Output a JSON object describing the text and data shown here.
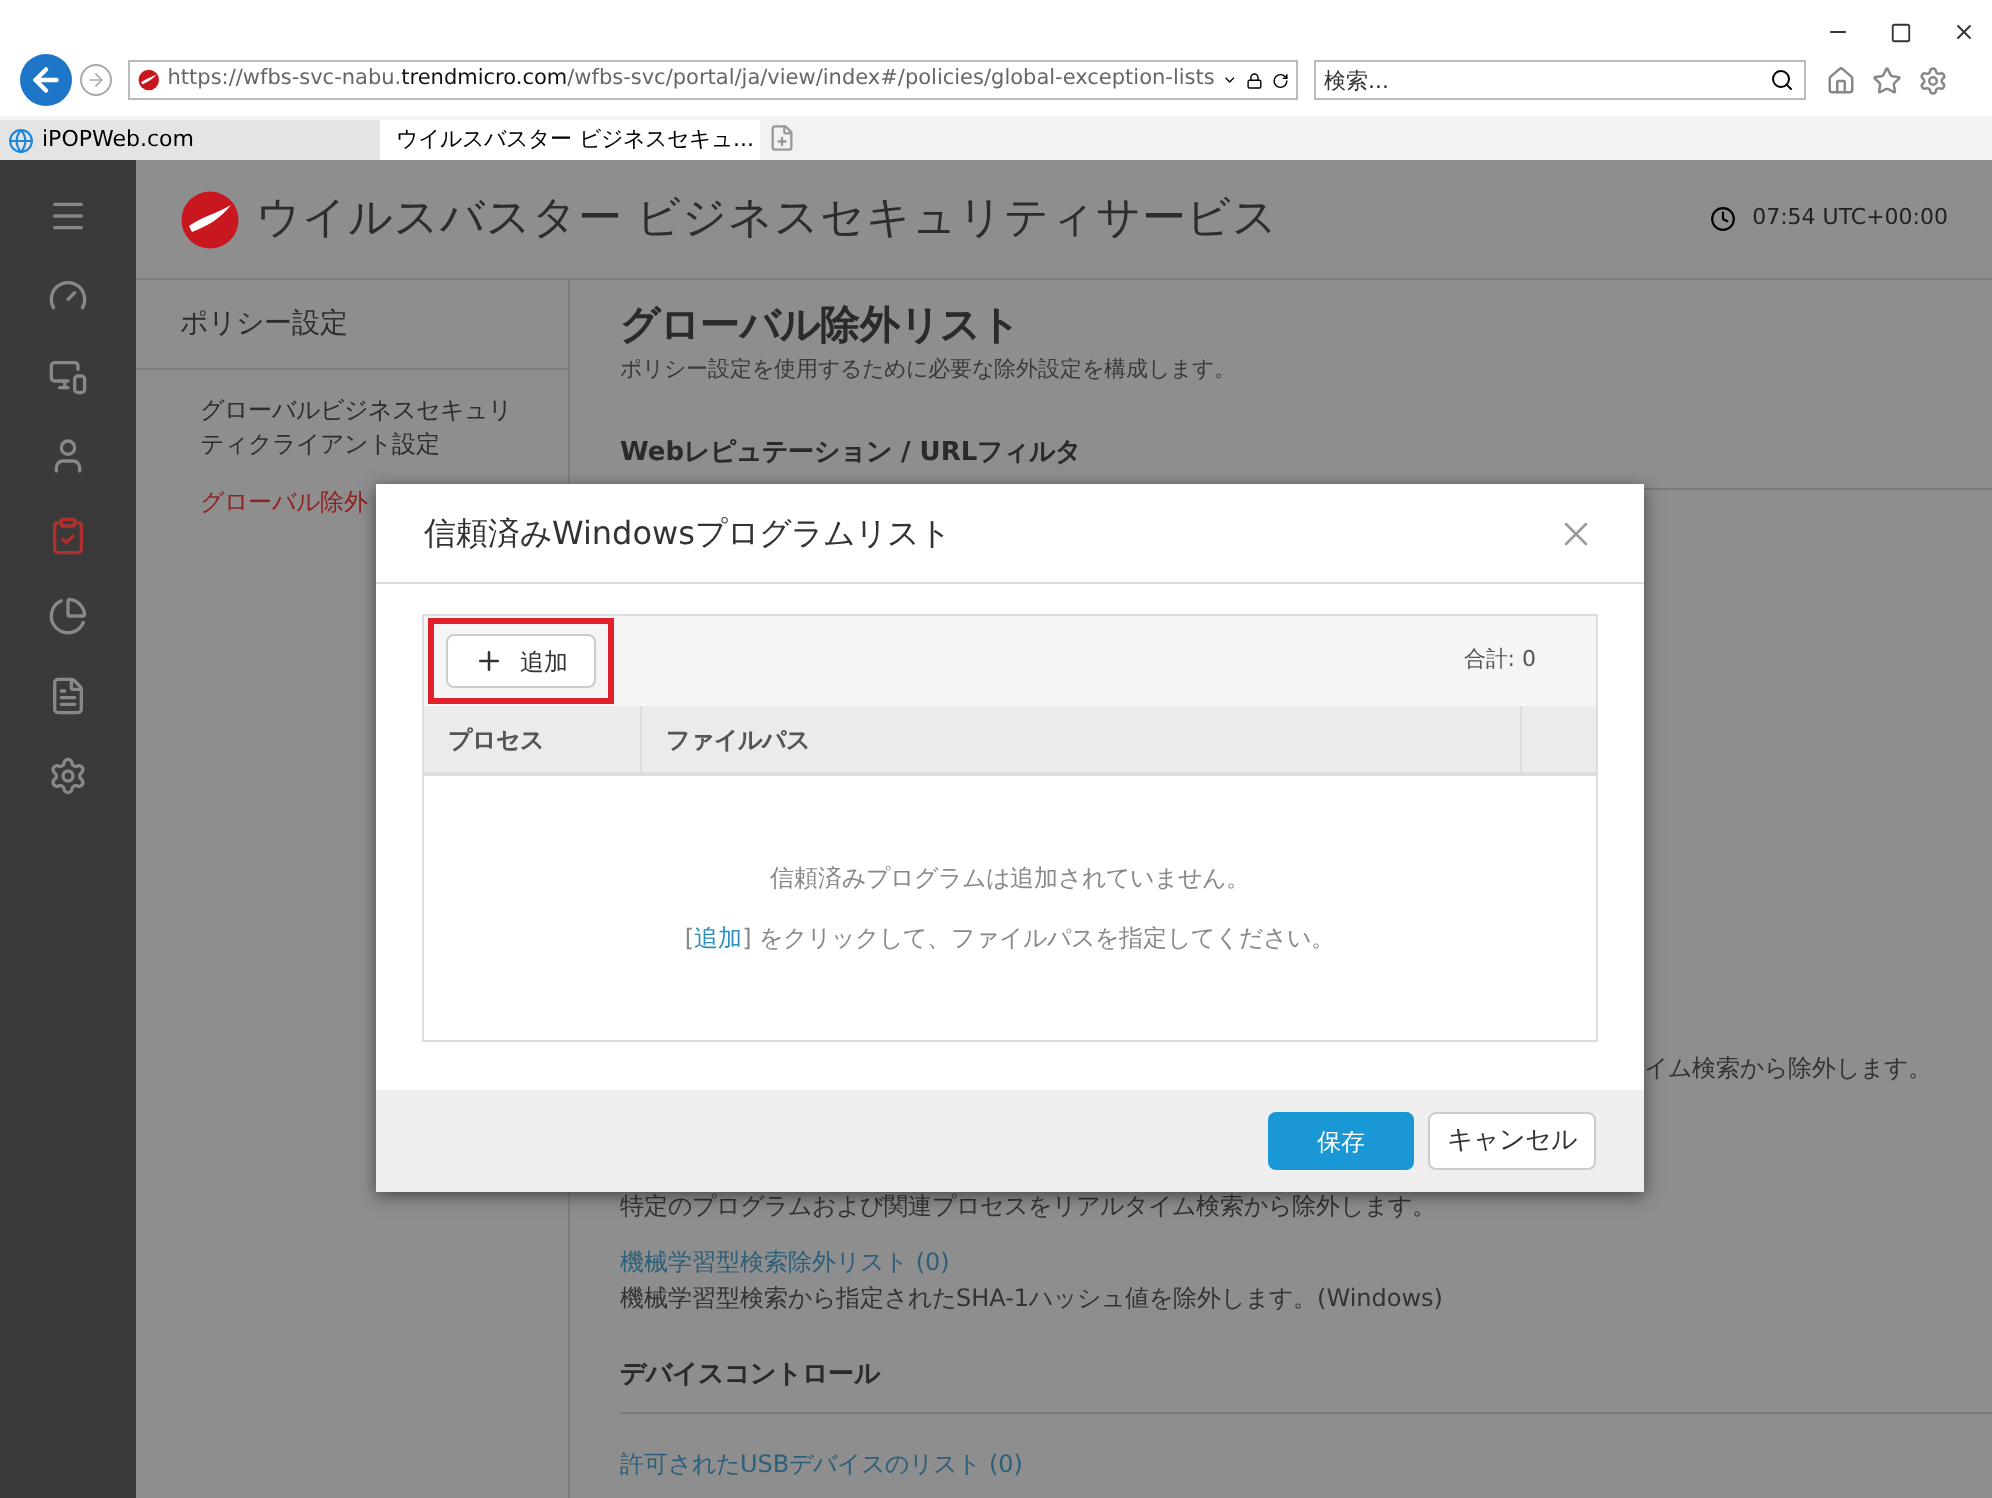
{
  "browser": {
    "url": "https://wfbs-svc-nabu.**trendmicro.com**/wfbs-svc/portal/ja/view/index#/policies/global-exception-lists",
    "search": {
      "placeholder": "検索..."
    },
    "tabs": [
      {
        "label": "iPOPWeb.com",
        "selected": false
      },
      {
        "label": "ウイルスバスター ビジネスセキュ...",
        "selected": true
      }
    ]
  },
  "app": {
    "title": "ウイルスバスター ビジネスセキュリティサービス",
    "clock": "07:54 UTC+00:00",
    "nav": [
      {
        "kind": "dashboard",
        "selected": false
      },
      {
        "kind": "devices",
        "selected": false
      },
      {
        "kind": "users",
        "selected": false
      },
      {
        "kind": "policies",
        "selected": true
      },
      {
        "kind": "reports",
        "selected": false
      },
      {
        "kind": "logs",
        "selected": false
      },
      {
        "kind": "settings",
        "selected": false
      }
    ]
  },
  "policy_panel": {
    "title": "ポリシー設定",
    "items": [
      {
        "label": "グローバルビジネスセキュリティクライアント設定",
        "selected": false
      },
      {
        "label": "グローバル除外",
        "selected": true
      }
    ]
  },
  "content": {
    "title": "グローバル除外リスト",
    "subtitle": "ポリシー設定を使用するために必要な除外設定を構成します。",
    "lines": [
      {
        "kind": "heading",
        "text": "Webレピュテーション / URLフィルタ"
      },
      {
        "kind": "fragment",
        "text": "イム検索から除外します。"
      },
      {
        "kind": "text",
        "text": "特定のプログラムおよび関連プロセスをリアルタイム検索から除外します。"
      },
      {
        "kind": "link",
        "text": "機械学習型検索除外リスト (0)"
      },
      {
        "kind": "text",
        "text": "機械学習型検索から指定されたSHA-1ハッシュ値を除外します。(Windows)"
      },
      {
        "kind": "heading",
        "text": "デバイスコントロール"
      },
      {
        "kind": "link",
        "text": "許可されたUSBデバイスのリスト (0)"
      }
    ]
  },
  "dialog": {
    "title": "信頼済みWindowsプログラムリスト",
    "add_button": {
      "label": "追加",
      "highlighted": true
    },
    "total": "合計: 0",
    "columns": [
      "プロセス",
      "ファイルパス"
    ],
    "empty_message": "信頼済みプログラムは追加されていません。",
    "empty_hint": {
      "before": "[",
      "link": "追加",
      "after": "] をクリックして、ファイルパスを指定してください。"
    },
    "save": "保存",
    "cancel": "キャンセル"
  }
}
